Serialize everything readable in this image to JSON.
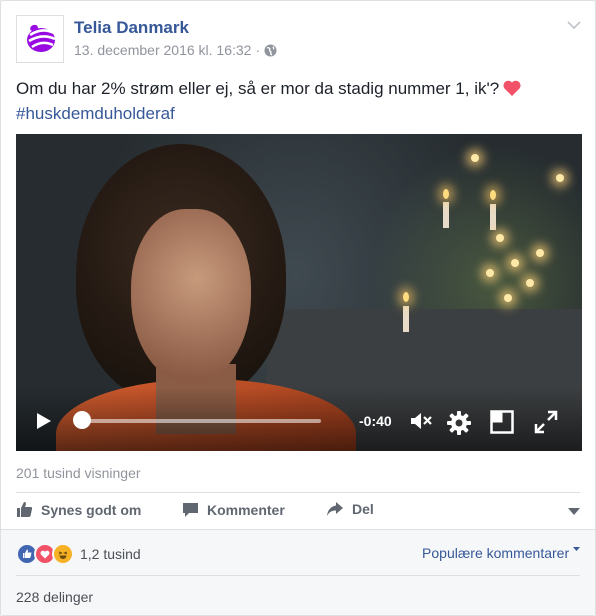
{
  "post": {
    "author": "Telia Danmark",
    "timestamp": "13. december 2016 kl. 16:32",
    "separator": "·",
    "text": "Om du har 2% strøm eller ej, så er mor da stadig nummer 1, ik'?",
    "hashtag": "#huskdemduholderaf"
  },
  "video": {
    "time_remaining": "-0:40",
    "progress_fraction": 0.02,
    "views": "201 tusind visninger"
  },
  "actions": {
    "like_label": "Synes godt om",
    "comment_label": "Kommenter",
    "share_label": "Del"
  },
  "footer": {
    "reaction_count": "1,2 tusind",
    "comments_filter": "Populære kommentarer",
    "shares": "228 delinger"
  },
  "colors": {
    "brand_purple": "#990ae3",
    "link_blue": "#365899",
    "like_blue": "#4267b2",
    "love_red": "#f25268",
    "haha_yellow": "#f7b125"
  },
  "icons": [
    "telia-logo-icon",
    "globe-icon",
    "chevron-down-icon",
    "heart-icon",
    "play-icon",
    "mute-icon",
    "settings-icon",
    "mini-player-icon",
    "fullscreen-icon",
    "thumbs-up-icon",
    "comment-icon",
    "share-arrow-icon",
    "like-reaction-icon",
    "love-reaction-icon",
    "haha-reaction-icon"
  ]
}
